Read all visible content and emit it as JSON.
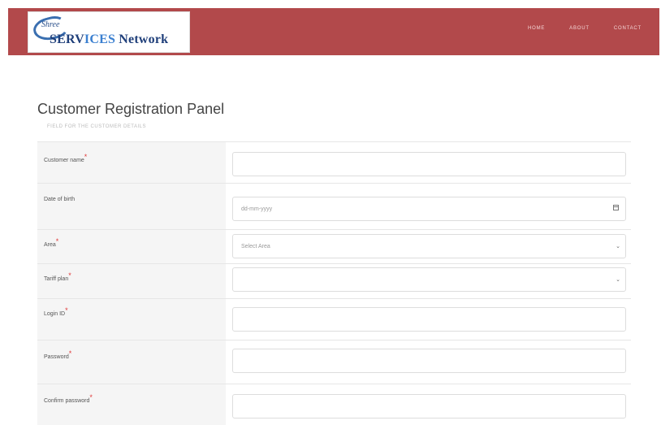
{
  "header": {
    "logo": {
      "small": "Shree",
      "main_prefix": "SERV",
      "main_a": "ICES",
      "main_suffix": " Network"
    },
    "nav": [
      "HOME",
      "ABOUT",
      "CONTACT"
    ]
  },
  "page": {
    "title": "Customer Registration Panel",
    "subtitle": "FIELD FOR THE CUSTOMER DETAILS"
  },
  "form": {
    "fields": [
      {
        "label": "Customer name",
        "required": true,
        "type": "text",
        "value": ""
      },
      {
        "label": "Date of birth",
        "required": false,
        "type": "date",
        "value": "dd-mm-yyyy"
      },
      {
        "label": "Area",
        "required": true,
        "type": "select",
        "value": "Select Area"
      },
      {
        "label": "Tariff plan",
        "required": true,
        "type": "select",
        "value": ""
      },
      {
        "label": "Login ID",
        "required": true,
        "type": "text",
        "value": ""
      },
      {
        "label": "Password",
        "required": true,
        "type": "text",
        "value": ""
      },
      {
        "label": "Confirm password",
        "required": true,
        "type": "text",
        "value": ""
      }
    ]
  },
  "colors": {
    "header_bg": "#b2494b",
    "required": "#e03b3b"
  },
  "icons": {
    "date": "calendar-icon",
    "select": "chevron-down-icon"
  }
}
